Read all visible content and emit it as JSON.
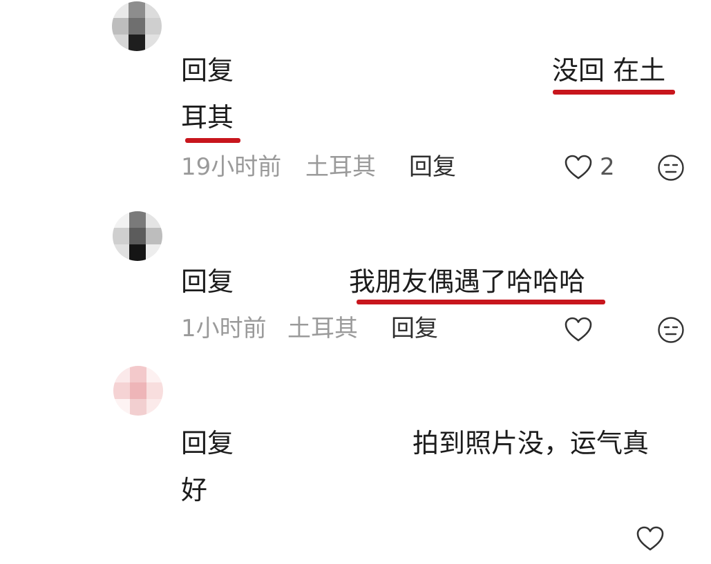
{
  "colors": {
    "underline": "#c8161d",
    "meta": "#9a9a9a",
    "text": "#1c1c1c"
  },
  "comments": [
    {
      "reply_prefix": "回复",
      "text_line1": "没回 在土",
      "text_line2": "耳其",
      "time": "19小时前",
      "location": "土耳其",
      "reply_action": "回复",
      "like_count": "2",
      "like_icon": "heart-outline-icon",
      "emoji_icon": "neutral-face-icon"
    },
    {
      "reply_prefix": "回复",
      "text_line1": "我朋友偶遇了哈哈哈",
      "time": "1小时前",
      "location": "土耳其",
      "reply_action": "回复",
      "like_icon": "heart-outline-icon",
      "emoji_icon": "neutral-face-icon"
    },
    {
      "reply_prefix": "回复",
      "text_line1": "拍到照片没，运气真",
      "text_line2": "好",
      "like_icon": "heart-outline-icon"
    }
  ]
}
